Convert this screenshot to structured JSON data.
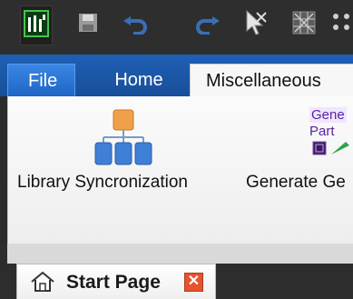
{
  "qat": {
    "buttons": [
      {
        "name": "app-logo",
        "icon": "app-logo-icon"
      },
      {
        "name": "save",
        "icon": "save-icon"
      },
      {
        "name": "undo",
        "icon": "undo-icon"
      },
      {
        "name": "redo",
        "icon": "redo-icon"
      },
      {
        "name": "pointer-tool",
        "icon": "pointer-cross-icon"
      },
      {
        "name": "grid-tool",
        "icon": "grid-icon"
      },
      {
        "name": "dots-tool",
        "icon": "dots-icon"
      }
    ]
  },
  "ribbon": {
    "tabs": [
      {
        "label": "File",
        "active": false
      },
      {
        "label": "Home",
        "active": false
      },
      {
        "label": "Miscellaneous",
        "active": true
      }
    ],
    "buttons": [
      {
        "label": "Library Syncronization",
        "icon": "library-sync-icon"
      },
      {
        "label": "Generate Ge",
        "icon": "generate-part-icon",
        "icon_text_1": "Gene",
        "icon_text_2": "Part"
      }
    ]
  },
  "document_tabs": [
    {
      "label": "Start Page",
      "icon": "home-icon",
      "close_label": "✕"
    }
  ],
  "colors": {
    "tab_bar": "#1f5fb5",
    "close_button": "#e5532f",
    "ribbon_bg": "#f2f2f2",
    "accent_purple": "#5a1fa6"
  }
}
